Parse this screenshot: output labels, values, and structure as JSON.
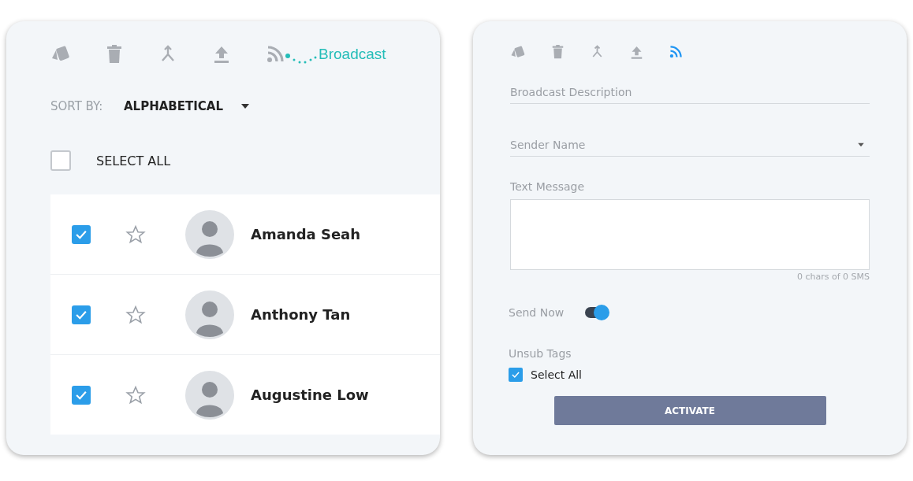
{
  "contacts_panel": {
    "toolbar": [
      {
        "kind": "cards",
        "selected": false
      },
      {
        "kind": "trash",
        "selected": false
      },
      {
        "kind": "merge",
        "selected": false
      },
      {
        "kind": "upload",
        "selected": false
      },
      {
        "kind": "rss",
        "selected": false
      }
    ],
    "tooltip": "Broadcast",
    "sort": {
      "label": "SORT BY:",
      "value": "ALPHABETICAL"
    },
    "select_all": {
      "label": "SELECT ALL",
      "checked": false
    },
    "contacts": [
      {
        "name": "Amanda Seah",
        "checked": true,
        "starred": false
      },
      {
        "name": "Anthony Tan",
        "checked": true,
        "starred": false
      },
      {
        "name": "Augustine Low",
        "checked": true,
        "starred": false
      }
    ]
  },
  "broadcast_panel": {
    "toolbar": [
      {
        "kind": "cards",
        "selected": false
      },
      {
        "kind": "trash",
        "selected": false
      },
      {
        "kind": "merge",
        "selected": false
      },
      {
        "kind": "upload",
        "selected": false
      },
      {
        "kind": "rss",
        "selected": true
      }
    ],
    "description": {
      "placeholder": "Broadcast Description"
    },
    "sender": {
      "placeholder": "Sender Name"
    },
    "message": {
      "label": "Text Message",
      "counter": "0 chars of 0 SMS"
    },
    "send_now": {
      "label": "Send Now",
      "on": true
    },
    "unsub_tags": {
      "label": "Unsub Tags",
      "select_all": {
        "label": "Select All",
        "checked": true
      }
    },
    "button": "ACTIVATE"
  }
}
